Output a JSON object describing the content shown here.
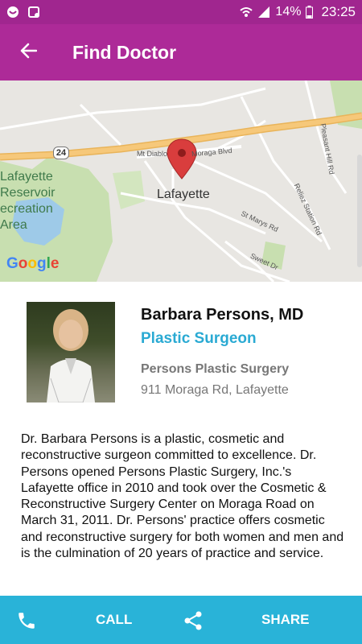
{
  "status_bar": {
    "battery": "14%",
    "time": "23:25",
    "icons": [
      "notification-icon",
      "sync-icon",
      "wifi-icon",
      "signal-icon",
      "battery-icon"
    ]
  },
  "app_bar": {
    "title": "Find Doctor",
    "back_icon": "arrow-back-icon"
  },
  "map": {
    "labels": {
      "reservoir": "Lafayette Reservoir Recreation Area",
      "reservoir_l1": "Lafayette",
      "reservoir_l2": "Reservoir",
      "reservoir_l3": "ecreation",
      "reservoir_l4": "Area",
      "city": "Lafayette",
      "highway": "24",
      "mt_diablo": "Mt Diablo",
      "moraga_blvd": "Moraga Blvd",
      "st_marys": "St Marys Rd",
      "sweet_dr": "Sweet Dr",
      "reliez": "Reliez Station Rd",
      "pleasant_hill": "Pleasant Hill Rd"
    },
    "attribution": "Google",
    "colors": {
      "road_major": "#f6c87a",
      "park": "#c8dfb0",
      "water": "#9ecae8"
    }
  },
  "doctor": {
    "name": "Barbara Persons, MD",
    "specialty": "Plastic Surgeon",
    "practice": "Persons Plastic Surgery",
    "address": "911 Moraga Rd, Lafayette",
    "bio": "Dr. Barbara Persons is a plastic, cosmetic and reconstructive surgeon committed to excellence. Dr. Persons opened Persons Plastic Surgery, Inc.'s Lafayette office in 2010 and took over the Cosmetic & Reconstructive Surgery Center on Moraga Road on March 31, 2011. Dr. Persons' practice offers cosmetic and reconstructive surgery for both women and men and is the culmination of 20 years of practice and service."
  },
  "actions": {
    "call_label": "CALL",
    "share_label": "SHARE",
    "call_icon": "phone-icon",
    "share_icon": "share-icon"
  },
  "colors": {
    "status_bar": "#a0268f",
    "app_bar": "#ad2a98",
    "accent": "#2aaad3",
    "action_bar": "#29b3d8"
  }
}
